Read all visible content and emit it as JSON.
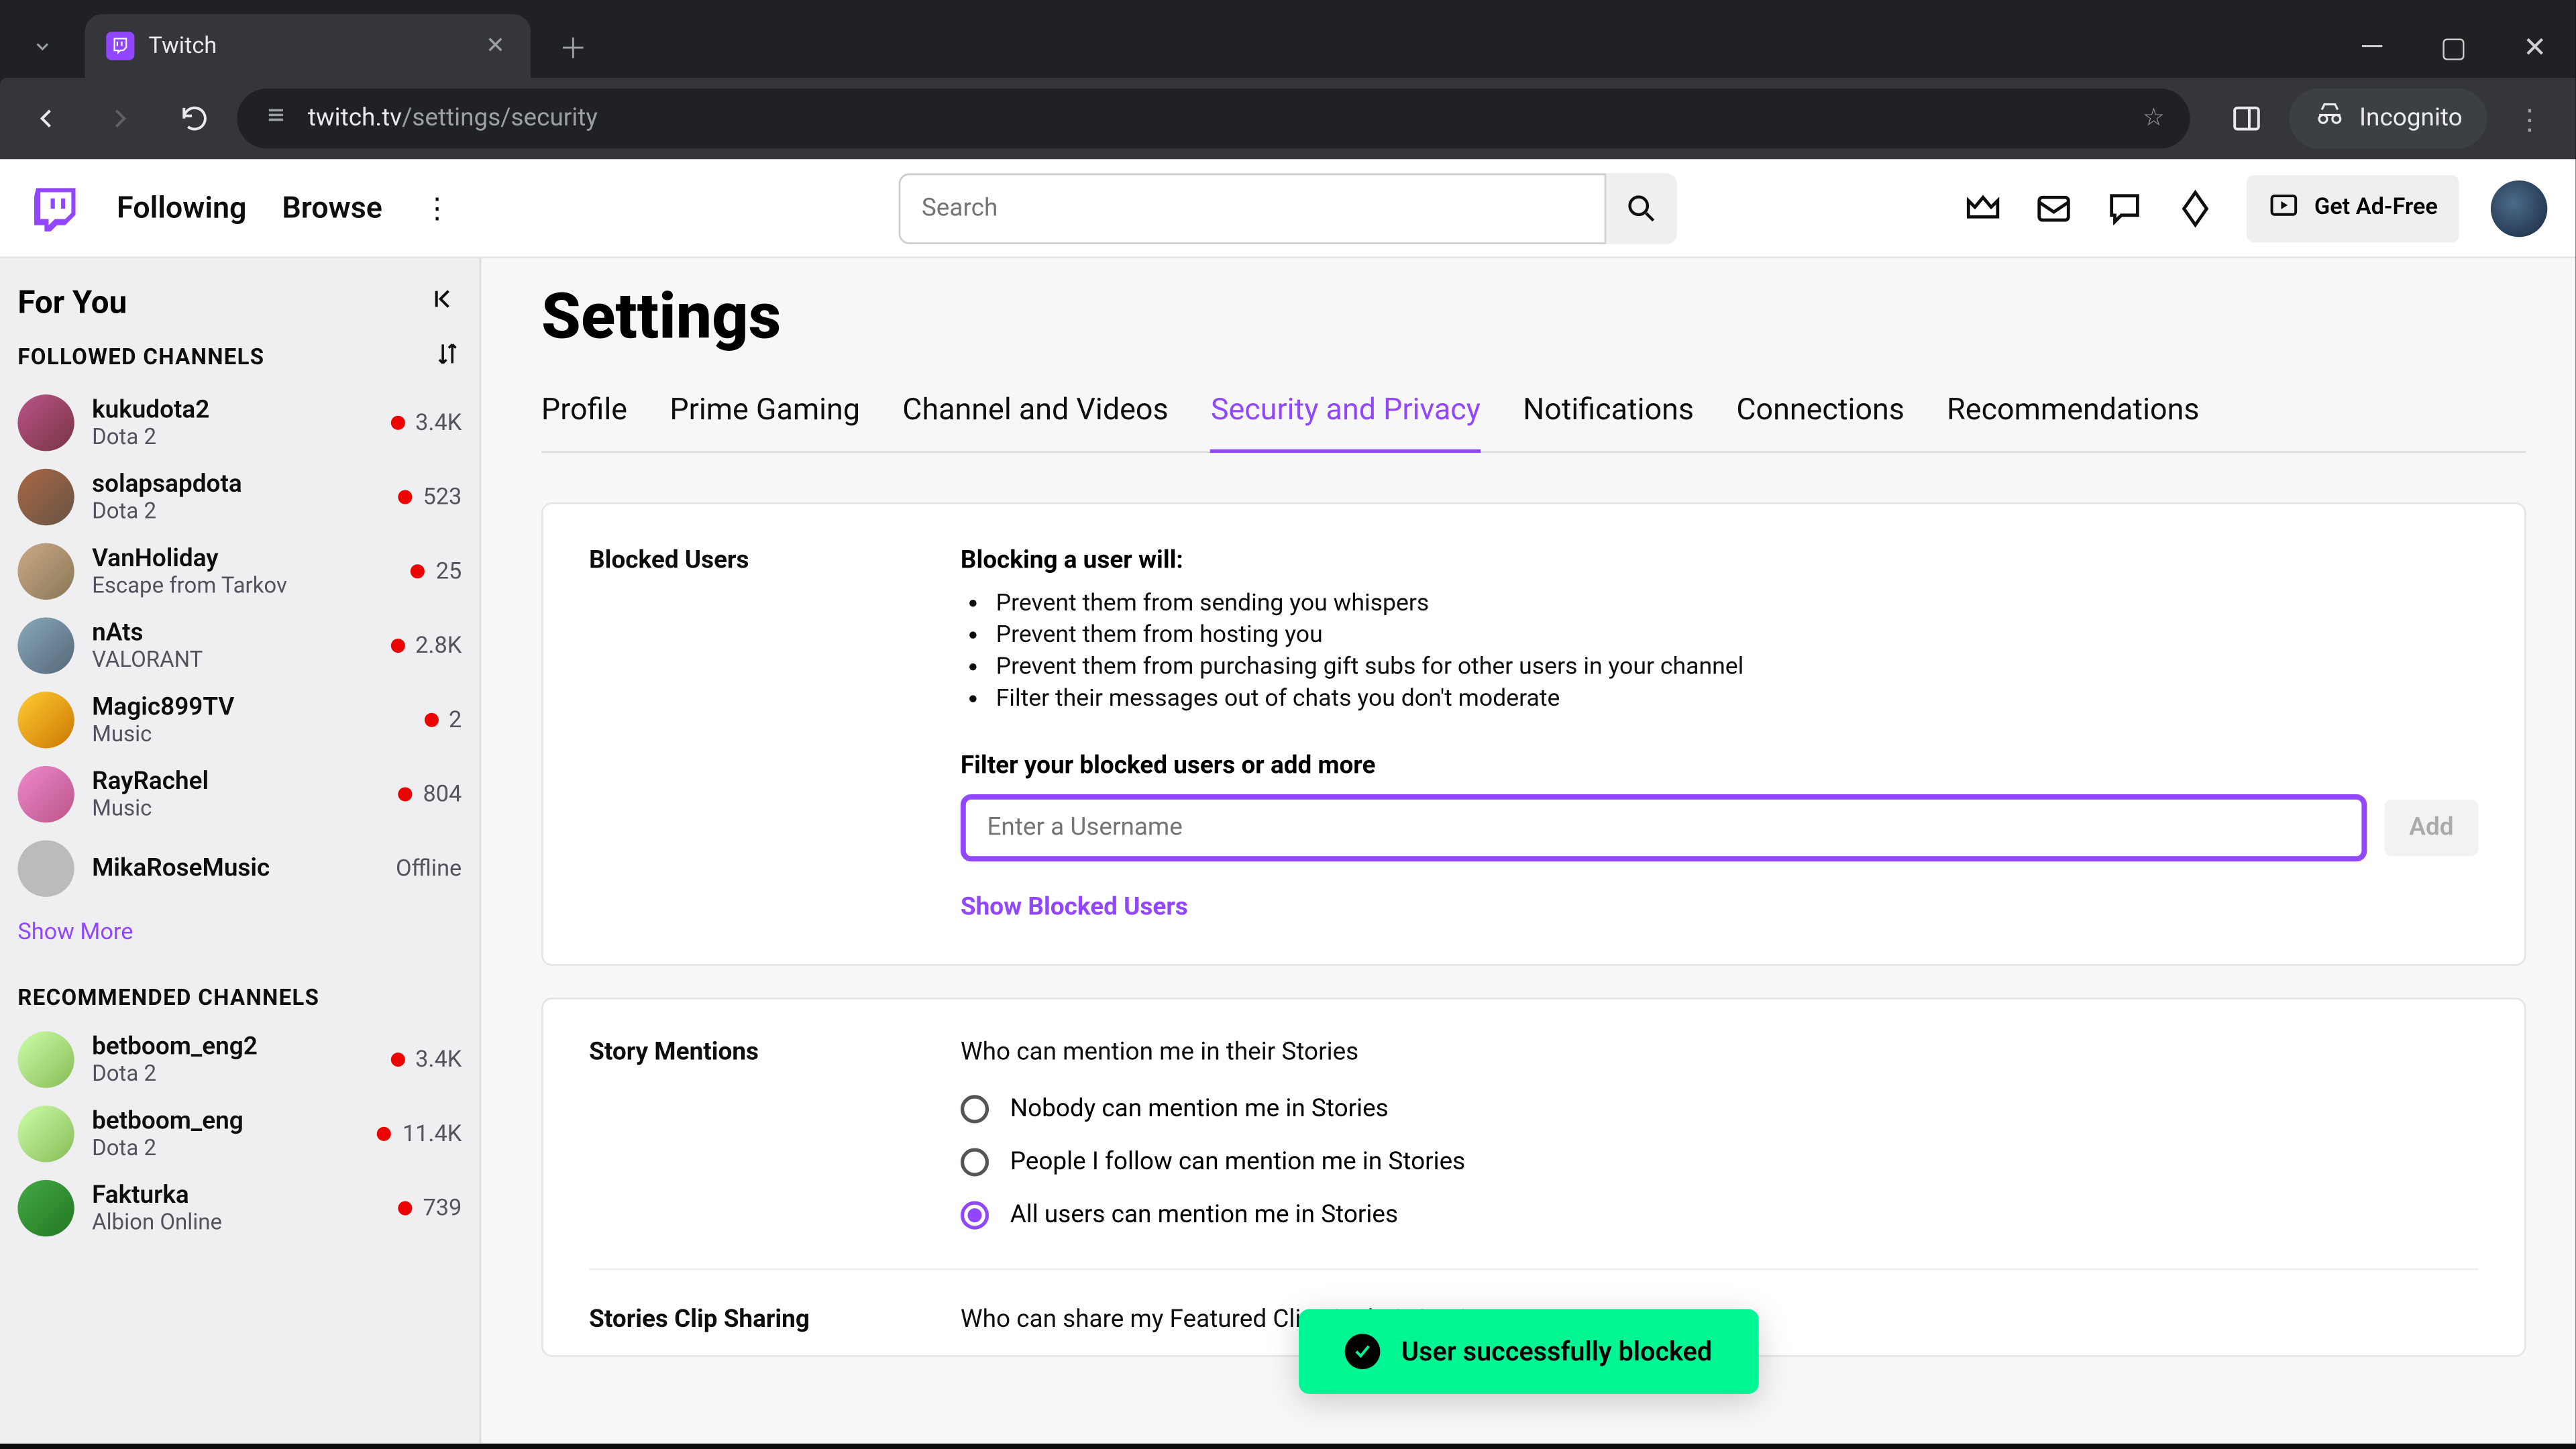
{
  "browser": {
    "tab_title": "Twitch",
    "url_host": "twitch.tv",
    "url_path": "/settings/security",
    "incognito_label": "Incognito"
  },
  "topnav": {
    "following": "Following",
    "browse": "Browse",
    "search_placeholder": "Search",
    "get_ad_free": "Get Ad-Free"
  },
  "sidebar": {
    "for_you": "For You",
    "followed_header": "FOLLOWED CHANNELS",
    "recommended_header": "RECOMMENDED CHANNELS",
    "show_more": "Show More",
    "offline_label": "Offline",
    "followed": [
      {
        "name": "kukudota2",
        "game": "Dota 2",
        "viewers": "3.4K",
        "live": true
      },
      {
        "name": "solapsapdota",
        "game": "Dota 2",
        "viewers": "523",
        "live": true
      },
      {
        "name": "VanHoliday",
        "game": "Escape from Tarkov",
        "viewers": "25",
        "live": true
      },
      {
        "name": "nAts",
        "game": "VALORANT",
        "viewers": "2.8K",
        "live": true
      },
      {
        "name": "Magic899TV",
        "game": "Music",
        "viewers": "2",
        "live": true
      },
      {
        "name": "RayRachel",
        "game": "Music",
        "viewers": "804",
        "live": true
      },
      {
        "name": "MikaRoseMusic",
        "game": "",
        "viewers": "",
        "live": false
      }
    ],
    "recommended": [
      {
        "name": "betboom_eng2",
        "game": "Dota 2",
        "viewers": "3.4K",
        "live": true
      },
      {
        "name": "betboom_eng",
        "game": "Dota 2",
        "viewers": "11.4K",
        "live": true
      },
      {
        "name": "Fakturka",
        "game": "Albion Online",
        "viewers": "739",
        "live": true
      }
    ]
  },
  "content": {
    "page_title": "Settings",
    "tabs": [
      "Profile",
      "Prime Gaming",
      "Channel and Videos",
      "Security and Privacy",
      "Notifications",
      "Connections",
      "Recommendations"
    ],
    "active_tab_index": 3,
    "blocked_users": {
      "label": "Blocked Users",
      "heading": "Blocking a user will:",
      "bullets": [
        "Prevent them from sending you whispers",
        "Prevent them from hosting you",
        "Prevent them from purchasing gift subs for other users in your channel",
        "Filter their messages out of chats you don't moderate"
      ],
      "filter_label": "Filter your blocked users or add more",
      "input_placeholder": "Enter a Username",
      "add_button": "Add",
      "show_blocked": "Show Blocked Users"
    },
    "story_mentions": {
      "label": "Story Mentions",
      "desc": "Who can mention me in their Stories",
      "options": [
        "Nobody can mention me in Stories",
        "People I follow can mention me in Stories",
        "All users can mention me in Stories"
      ],
      "selected_index": 2
    },
    "clip_sharing": {
      "label": "Stories Clip Sharing",
      "desc": "Who can share my Featured Clips in their Stories"
    }
  },
  "toast": {
    "message": "User successfully blocked"
  }
}
